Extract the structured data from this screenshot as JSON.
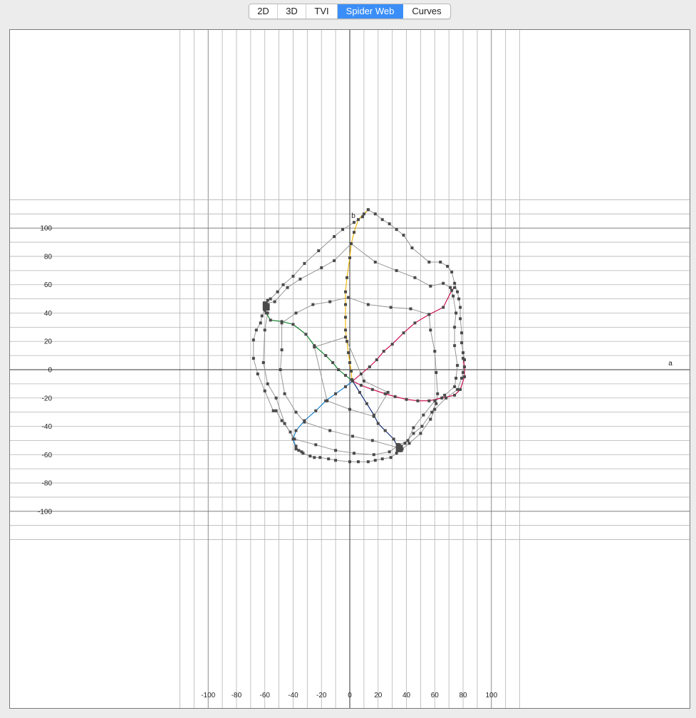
{
  "toolbar": {
    "tabs": [
      {
        "label": "2D",
        "active": false
      },
      {
        "label": "3D",
        "active": false
      },
      {
        "label": "TVI",
        "active": false
      },
      {
        "label": "Spider Web",
        "active": true
      },
      {
        "label": "Curves",
        "active": false
      }
    ],
    "accent_color": "#3b8ef7"
  },
  "chart_data": {
    "type": "scatter",
    "title": "",
    "xlabel": "a",
    "ylabel": "b",
    "xlim": [
      -120,
      120
    ],
    "ylim": [
      -110,
      118
    ],
    "grid": true,
    "x_ticks": [
      "-100",
      "-80",
      "-60",
      "-40",
      "-20",
      "0",
      "20",
      "40",
      "60",
      "80",
      "100"
    ],
    "y_ticks": [
      "100",
      "80",
      "60",
      "40",
      "20",
      "0",
      "-20",
      "-40",
      "-60",
      "-80",
      "-100"
    ],
    "center": [
      2,
      -8
    ],
    "colors": {
      "grid": "#b4b4b4",
      "axis": "#333333",
      "ring": "#8c8c8c",
      "marker": "#4a4a4a",
      "yellow": "#f0b400",
      "magenta": "#c8004b",
      "green": "#007a1e",
      "blue": "#0a78c8",
      "navy": "#001e6e"
    },
    "rings": [
      [
        [
          0,
          -28
        ],
        [
          17,
          -33
        ],
        [
          27,
          -16
        ],
        [
          10,
          -8
        ],
        [
          -3,
          23
        ],
        [
          -25,
          16
        ],
        [
          -16,
          -22
        ],
        [
          0,
          -28
        ]
      ],
      [
        [
          -1,
          51
        ],
        [
          13,
          46
        ],
        [
          29,
          44
        ],
        [
          43,
          43
        ],
        [
          56,
          39
        ],
        [
          57,
          28
        ],
        [
          60,
          13
        ],
        [
          61,
          -2
        ],
        [
          62,
          -17
        ],
        [
          61,
          -24
        ],
        [
          58,
          -30
        ],
        [
          51,
          -40
        ],
        [
          45,
          -45
        ],
        [
          39,
          -52
        ],
        [
          34,
          -55
        ],
        [
          16,
          -50
        ],
        [
          2,
          -47
        ],
        [
          -14,
          -43
        ],
        [
          -32,
          -37
        ],
        [
          -38,
          -30
        ],
        [
          -46,
          -17
        ],
        [
          -49,
          0
        ],
        [
          -48,
          14
        ],
        [
          -48,
          33
        ],
        [
          -38,
          40
        ],
        [
          -26,
          46
        ],
        [
          -14,
          48
        ],
        [
          -1,
          51
        ]
      ],
      [
        [
          1,
          89
        ],
        [
          18,
          76
        ],
        [
          33,
          70
        ],
        [
          46,
          65
        ],
        [
          57,
          59
        ],
        [
          66,
          61
        ],
        [
          71,
          58
        ],
        [
          73,
          52
        ],
        [
          75,
          40
        ],
        [
          74,
          30
        ],
        [
          74,
          17
        ],
        [
          76,
          3
        ],
        [
          75,
          -6
        ],
        [
          74,
          -12
        ],
        [
          67,
          -18
        ],
        [
          60,
          -22
        ],
        [
          52,
          -32
        ],
        [
          45,
          -41
        ],
        [
          41,
          -50
        ],
        [
          35,
          -53
        ],
        [
          28,
          -58
        ],
        [
          17,
          -60
        ],
        [
          3,
          -59
        ],
        [
          -10,
          -57
        ],
        [
          -24,
          -53
        ],
        [
          -39,
          -49
        ],
        [
          -46,
          -38
        ],
        [
          -52,
          -20
        ],
        [
          -58,
          -10
        ],
        [
          -61,
          5
        ],
        [
          -60,
          28
        ],
        [
          -58,
          40
        ],
        [
          -59,
          47
        ],
        [
          -53,
          48
        ],
        [
          -44,
          58
        ],
        [
          -35,
          64
        ],
        [
          -20,
          72
        ],
        [
          -11,
          77
        ],
        [
          1,
          89
        ]
      ],
      [
        [
          3,
          104
        ],
        [
          9,
          108
        ],
        [
          13,
          113
        ],
        [
          18,
          110
        ],
        [
          23,
          106
        ],
        [
          28,
          103
        ],
        [
          33,
          99
        ],
        [
          38,
          95
        ],
        [
          44,
          86
        ],
        [
          56,
          76
        ],
        [
          64,
          76
        ],
        [
          69,
          73
        ],
        [
          72,
          69
        ],
        [
          74,
          61
        ],
        [
          76,
          55
        ],
        [
          77,
          50
        ],
        [
          78,
          44
        ],
        [
          78,
          36
        ],
        [
          79,
          26
        ],
        [
          79,
          19
        ],
        [
          80,
          12
        ],
        [
          81,
          7
        ],
        [
          80,
          -2
        ],
        [
          79,
          -6
        ],
        [
          76,
          -14
        ],
        [
          68,
          -20
        ],
        [
          60,
          -28
        ],
        [
          57,
          -35
        ],
        [
          50,
          -45
        ],
        [
          42,
          -52
        ],
        [
          37,
          -56
        ],
        [
          33,
          -59
        ],
        [
          29,
          -62
        ],
        [
          23,
          -63
        ],
        [
          18,
          -64
        ],
        [
          13,
          -65
        ],
        [
          6,
          -65
        ],
        [
          0,
          -65
        ],
        [
          -10,
          -64
        ],
        [
          -15,
          -63
        ],
        [
          -21,
          -62
        ],
        [
          -25,
          -62
        ],
        [
          -28,
          -61
        ],
        [
          -33,
          -59
        ],
        [
          -36,
          -57
        ],
        [
          -38,
          -54
        ],
        [
          -40,
          -49
        ],
        [
          -42,
          -44
        ],
        [
          -48,
          -36
        ],
        [
          -52,
          -29
        ],
        [
          -54,
          -29
        ],
        [
          -60,
          -15
        ],
        [
          -65,
          -3
        ],
        [
          -68,
          8
        ],
        [
          -68,
          21
        ],
        [
          -66,
          28
        ],
        [
          -63,
          33
        ],
        [
          -62,
          38
        ],
        [
          -60,
          42
        ],
        [
          -58,
          49
        ],
        [
          -56,
          50
        ],
        [
          -51,
          55
        ],
        [
          -47,
          60
        ],
        [
          -40,
          66
        ],
        [
          -32,
          75
        ],
        [
          -22,
          84
        ],
        [
          -11,
          94
        ],
        [
          -5,
          99
        ],
        [
          3,
          104
        ]
      ]
    ],
    "spokes": [
      {
        "name": "",
        "color_key": "yellow",
        "points": [
          [
            1.5,
            -7
          ],
          [
            1,
            -1
          ],
          [
            0,
            5
          ],
          [
            -1,
            12
          ],
          [
            -2,
            20
          ],
          [
            -3,
            28
          ],
          [
            -3,
            37
          ],
          [
            -3,
            46
          ],
          [
            -3,
            55
          ],
          [
            -2,
            65
          ],
          [
            0,
            79
          ],
          [
            1,
            89
          ],
          [
            3,
            97
          ],
          [
            6,
            106
          ],
          [
            10,
            110
          ],
          [
            13,
            113
          ]
        ]
      },
      {
        "name": "",
        "color_key": "magenta",
        "points": [
          [
            2,
            -8
          ],
          [
            8,
            -11
          ],
          [
            16,
            -14
          ],
          [
            25,
            -17
          ],
          [
            32,
            -19
          ],
          [
            40,
            -21
          ],
          [
            48,
            -22
          ],
          [
            56,
            -22
          ],
          [
            65,
            -20
          ],
          [
            74,
            -18
          ],
          [
            78,
            -14
          ],
          [
            81,
            -5
          ],
          [
            81,
            2
          ],
          [
            80,
            8
          ]
        ]
      },
      {
        "name": "",
        "color_key": "magenta",
        "points": [
          [
            2,
            -8
          ],
          [
            8,
            -3
          ],
          [
            14,
            2
          ],
          [
            19,
            7
          ],
          [
            24,
            13
          ],
          [
            30,
            18
          ],
          [
            38,
            26
          ],
          [
            46,
            33
          ],
          [
            56,
            39
          ],
          [
            66,
            44
          ],
          [
            72,
            56
          ],
          [
            74,
            58
          ]
        ]
      },
      {
        "name": "",
        "color_key": "green",
        "points": [
          [
            2,
            -8
          ],
          [
            -3,
            -4
          ],
          [
            -8,
            0
          ],
          [
            -12,
            5
          ],
          [
            -17,
            10
          ],
          [
            -25,
            17
          ],
          [
            -31,
            25
          ],
          [
            -40,
            32
          ],
          [
            -48,
            34
          ],
          [
            -56,
            35
          ],
          [
            -59,
            40
          ],
          [
            -60,
            45
          ]
        ]
      },
      {
        "name": "",
        "color_key": "blue",
        "points": [
          [
            2,
            -8
          ],
          [
            -3,
            -12
          ],
          [
            -10,
            -17
          ],
          [
            -17,
            -22
          ],
          [
            -24,
            -29
          ],
          [
            -32,
            -36
          ],
          [
            -38,
            -43
          ],
          [
            -40,
            -49
          ],
          [
            -38,
            -56
          ],
          [
            -34,
            -58
          ]
        ]
      },
      {
        "name": "",
        "color_key": "navy",
        "points": [
          [
            2,
            -8
          ],
          [
            7,
            -16
          ],
          [
            12,
            -24
          ],
          [
            17,
            -32
          ],
          [
            20,
            -38
          ],
          [
            25,
            -43
          ],
          [
            31,
            -49
          ],
          [
            34,
            -55
          ]
        ]
      }
    ],
    "clusters": [
      [
        -59,
        45
      ],
      [
        35,
        -55
      ]
    ]
  }
}
